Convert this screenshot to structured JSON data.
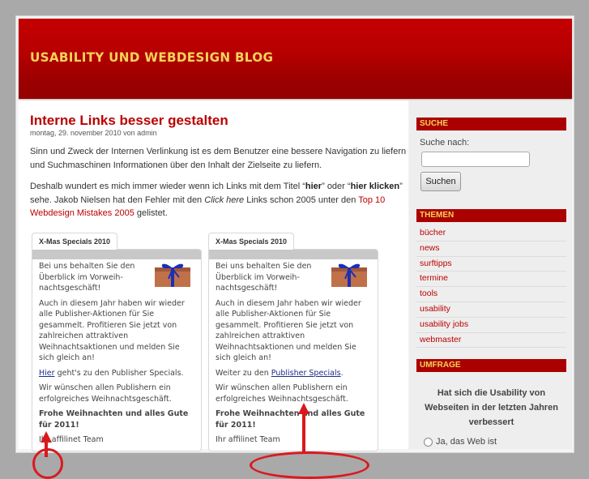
{
  "site": {
    "title": "USABILITY UND WEBDESIGN BLOG",
    "colors": {
      "header_red": "#b80000",
      "title_yellow": "#f5d35a",
      "link_red": "#bb0000",
      "annotation_red": "#d9191e"
    }
  },
  "post": {
    "title": "Interne Links besser gestalten",
    "meta": "montag, 29. november 2010 von admin",
    "p1": "Sinn und Zweck der Internen Verlinkung ist es dem Benutzer eine bessere Navigation zu liefern und Suchmaschinen Informationen über den Inhalt der Zielseite zu liefern.",
    "p2_a": "Deshalb wundert es mich immer wieder wenn ich Links mit dem Titel “",
    "p2_b1": "hier",
    "p2_c": "” oder “",
    "p2_b2": "hier klicken",
    "p2_d": "” sehe. Jakob Nielsen hat den Fehler mit den ",
    "p2_em": "Click here",
    "p2_e": " Links schon 2005 unter den ",
    "p2_link": "Top 10 Webdesign Mistakes 2005",
    "p2_f": " gelistet."
  },
  "screenshots": [
    {
      "tab": "X-Mas Specials 2010",
      "intro": "Bei uns behalten Sie den Überblick im Vorweih-nachtsgeschäft!",
      "body": "Auch in diesem Jahr haben wir wieder alle Publisher-Aktionen für Sie gesammelt. Profitieren Sie jetzt von zahlreichen attraktiven Weihnachtsaktionen und melden Sie sich gleich an!",
      "link_pre": "",
      "link_text": "Hier",
      "link_post": " geht's zu den Publisher Specials.",
      "wish": "Wir wünschen allen Publishern ein erfolgreiches Weihnachtsgeschäft.",
      "greeting": "Frohe Weihnachten und alles Gute für 2011!",
      "sign": "Ihr affilinet Team"
    },
    {
      "tab": "X-Mas Specials 2010",
      "intro": "Bei uns behalten Sie den Überblick im Vorweih-nachtsgeschäft!",
      "body": "Auch in diesem Jahr haben wir wieder alle Publisher-Aktionen für Sie gesammelt. Profitieren Sie jetzt von zahlreichen attraktiven Weihnachtsaktionen und melden Sie sich gleich an!",
      "link_pre": "Weiter zu den ",
      "link_text": "Publisher Specials",
      "link_post": ".",
      "wish": "Wir wünschen allen Publishern ein erfolgreiches Weihnachtsgeschäft.",
      "greeting": "Frohe Weihnachten und alles Gute für 2011!",
      "sign": "Ihr affilinet Team"
    }
  ],
  "sidebar": {
    "search": {
      "title": "SUCHE",
      "label": "Suche nach:",
      "value": "",
      "button": "Suchen"
    },
    "topics": {
      "title": "THEMEN",
      "items": [
        "bücher",
        "news",
        "surftipps",
        "termine",
        "tools",
        "usability",
        "usability jobs",
        "webmaster"
      ]
    },
    "poll": {
      "title": "UMFRAGE",
      "question": "Hat sich die Usability von Webseiten in der letzten Jahren verbessert",
      "options": [
        "Ja, das Web ist"
      ]
    }
  }
}
